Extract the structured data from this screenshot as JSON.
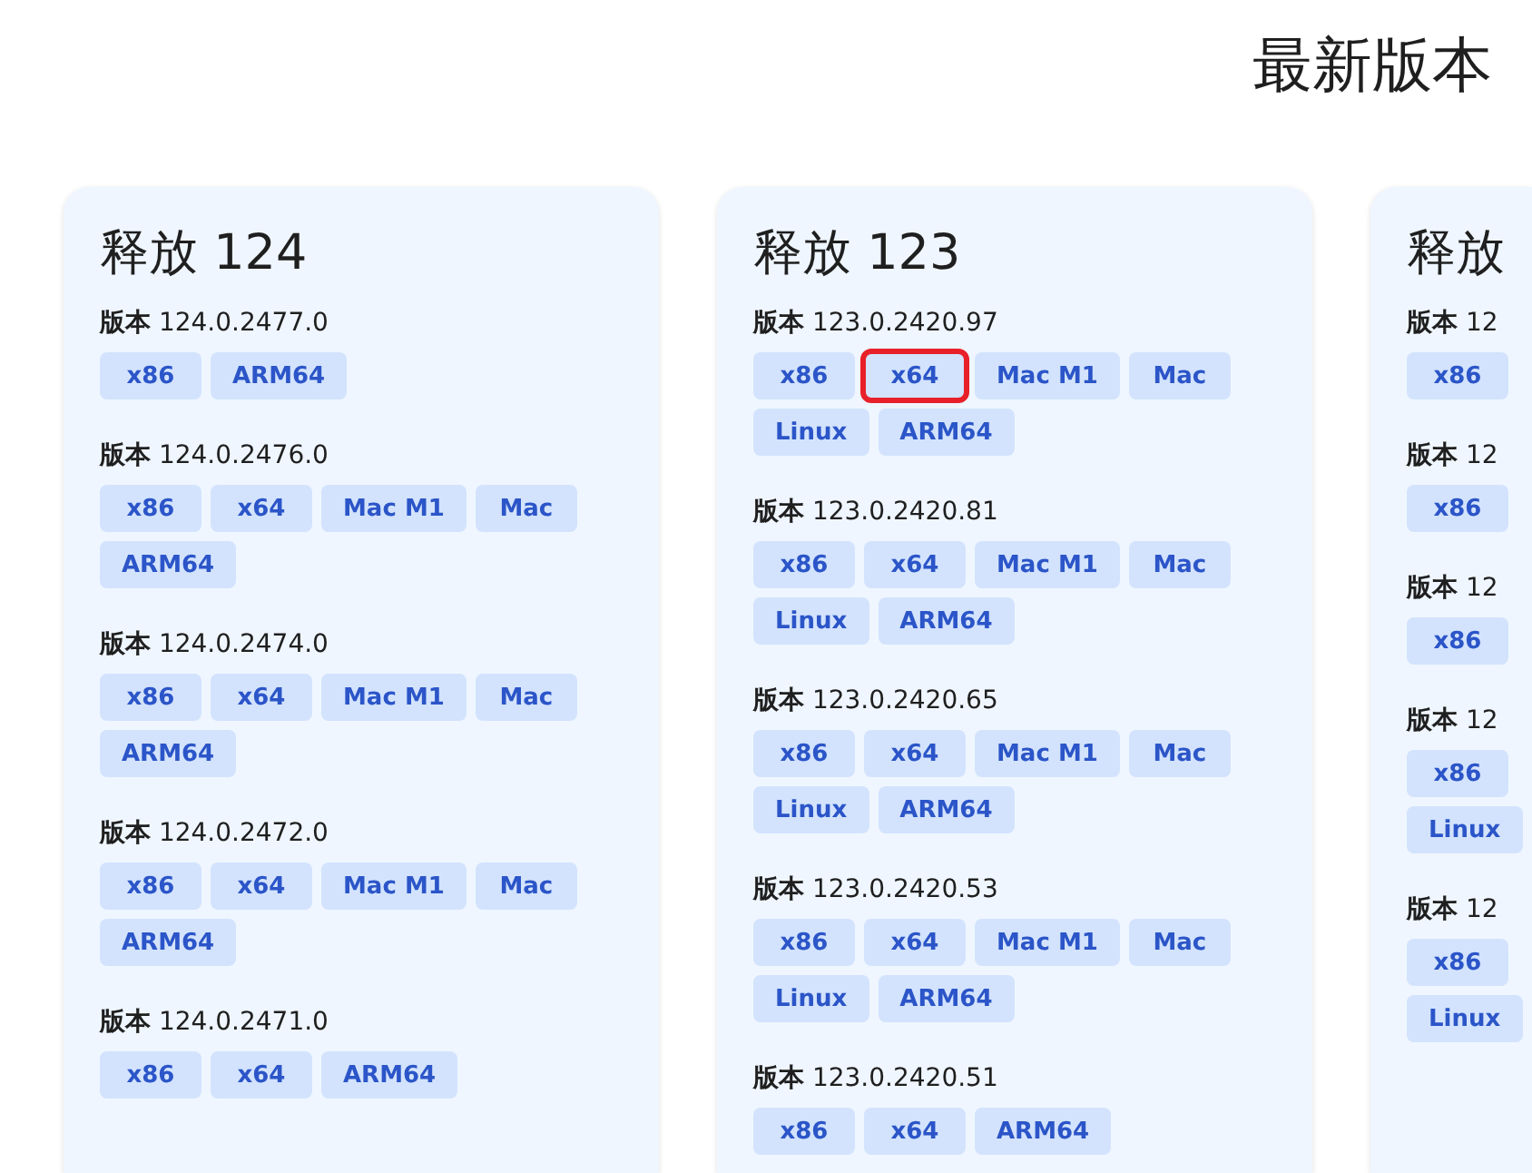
{
  "page_title": "最新版本",
  "releases": [
    {
      "title": "释放 124",
      "versions": [
        {
          "label": "**版本** 124.0.2477.0",
          "tags": [
            {
              "label": "x86",
              "highlighted": false
            },
            {
              "label": "ARM64",
              "highlighted": false
            }
          ]
        },
        {
          "label": "**版本** 124.0.2476.0",
          "tags": [
            {
              "label": "x86",
              "highlighted": false
            },
            {
              "label": "x64",
              "highlighted": false
            },
            {
              "label": "Mac M1",
              "highlighted": false
            },
            {
              "label": "Mac",
              "highlighted": false
            },
            {
              "label": "ARM64",
              "highlighted": false
            }
          ]
        },
        {
          "label": "**版本** 124.0.2474.0",
          "tags": [
            {
              "label": "x86",
              "highlighted": false
            },
            {
              "label": "x64",
              "highlighted": false
            },
            {
              "label": "Mac M1",
              "highlighted": false
            },
            {
              "label": "Mac",
              "highlighted": false
            },
            {
              "label": "ARM64",
              "highlighted": false
            }
          ]
        },
        {
          "label": "**版本** 124.0.2472.0",
          "tags": [
            {
              "label": "x86",
              "highlighted": false
            },
            {
              "label": "x64",
              "highlighted": false
            },
            {
              "label": "Mac M1",
              "highlighted": false
            },
            {
              "label": "Mac",
              "highlighted": false
            },
            {
              "label": "ARM64",
              "highlighted": false
            }
          ]
        },
        {
          "label": "**版本** 124.0.2471.0",
          "tags": [
            {
              "label": "x86",
              "highlighted": false
            },
            {
              "label": "x64",
              "highlighted": false
            },
            {
              "label": "ARM64",
              "highlighted": false
            }
          ]
        }
      ]
    },
    {
      "title": "释放 123",
      "versions": [
        {
          "label": "**版本** 123.0.2420.97",
          "tags": [
            {
              "label": "x86",
              "highlighted": false
            },
            {
              "label": "x64",
              "highlighted": true
            },
            {
              "label": "Mac M1",
              "highlighted": false
            },
            {
              "label": "Mac",
              "highlighted": false
            },
            {
              "label": "Linux",
              "highlighted": false
            },
            {
              "label": "ARM64",
              "highlighted": false
            }
          ]
        },
        {
          "label": "**版本** 123.0.2420.81",
          "tags": [
            {
              "label": "x86",
              "highlighted": false
            },
            {
              "label": "x64",
              "highlighted": false
            },
            {
              "label": "Mac M1",
              "highlighted": false
            },
            {
              "label": "Mac",
              "highlighted": false
            },
            {
              "label": "Linux",
              "highlighted": false
            },
            {
              "label": "ARM64",
              "highlighted": false
            }
          ]
        },
        {
          "label": "**版本** 123.0.2420.65",
          "tags": [
            {
              "label": "x86",
              "highlighted": false
            },
            {
              "label": "x64",
              "highlighted": false
            },
            {
              "label": "Mac M1",
              "highlighted": false
            },
            {
              "label": "Mac",
              "highlighted": false
            },
            {
              "label": "Linux",
              "highlighted": false
            },
            {
              "label": "ARM64",
              "highlighted": false
            }
          ]
        },
        {
          "label": "**版本** 123.0.2420.53",
          "tags": [
            {
              "label": "x86",
              "highlighted": false
            },
            {
              "label": "x64",
              "highlighted": false
            },
            {
              "label": "Mac M1",
              "highlighted": false
            },
            {
              "label": "Mac",
              "highlighted": false
            },
            {
              "label": "Linux",
              "highlighted": false
            },
            {
              "label": "ARM64",
              "highlighted": false
            }
          ]
        },
        {
          "label": "**版本** 123.0.2420.51",
          "tags": [
            {
              "label": "x86",
              "highlighted": false
            },
            {
              "label": "x64",
              "highlighted": false
            },
            {
              "label": "ARM64",
              "highlighted": false
            }
          ]
        }
      ]
    },
    {
      "title": "释放",
      "versions": [
        {
          "label": "**版本** 12",
          "tags": [
            {
              "label": "x86",
              "highlighted": false
            }
          ]
        },
        {
          "label": "**版本** 12",
          "tags": [
            {
              "label": "x86",
              "highlighted": false
            }
          ]
        },
        {
          "label": "**版本** 12",
          "tags": [
            {
              "label": "x86",
              "highlighted": false
            }
          ]
        },
        {
          "label": "**版本** 12",
          "tags": [
            {
              "label": "x86",
              "highlighted": false
            },
            {
              "label": "Linux",
              "highlighted": false
            }
          ]
        },
        {
          "label": "**版本** 12",
          "tags": [
            {
              "label": "x86",
              "highlighted": false
            },
            {
              "label": "Linux",
              "highlighted": false
            }
          ]
        }
      ]
    }
  ]
}
